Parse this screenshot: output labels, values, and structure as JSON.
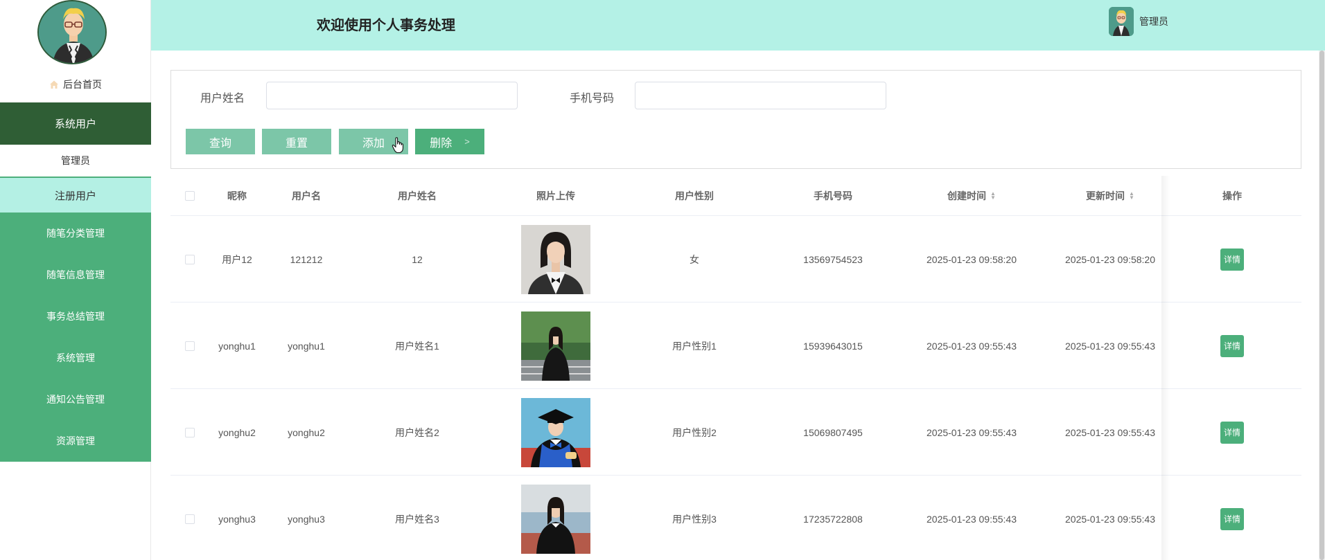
{
  "sidebar": {
    "home_label": "后台首页",
    "group_label": "系统用户",
    "sub_items": [
      "管理员",
      "注册用户"
    ],
    "menu_items": [
      "随笔分类管理",
      "随笔信息管理",
      "事务总结管理",
      "系统管理",
      "通知公告管理",
      "资源管理"
    ]
  },
  "header": {
    "title": "欢迎使用个人事务处理",
    "user_label": "管理员"
  },
  "search": {
    "name_label": "用户姓名",
    "name_value": "",
    "phone_label": "手机号码",
    "phone_value": "",
    "buttons": {
      "query": "查询",
      "reset": "重置",
      "add": "添加",
      "delete": "删除",
      "delete_arrow": ">"
    }
  },
  "table": {
    "columns": [
      "昵称",
      "用户名",
      "用户姓名",
      "照片上传",
      "用户性别",
      "手机号码",
      "创建时间",
      "更新时间",
      "操作"
    ],
    "rows": [
      {
        "nickname": "用户12",
        "username": "121212",
        "realname": "12",
        "gender": "女",
        "phone": "13569754523",
        "created": "2025-01-23 09:58:20",
        "updated": "2025-01-23 09:58:20",
        "action": "详情"
      },
      {
        "nickname": "yonghu1",
        "username": "yonghu1",
        "realname": "用户姓名1",
        "gender": "用户性别1",
        "phone": "15939643015",
        "created": "2025-01-23 09:55:43",
        "updated": "2025-01-23 09:55:43",
        "action": "详情"
      },
      {
        "nickname": "yonghu2",
        "username": "yonghu2",
        "realname": "用户姓名2",
        "gender": "用户性别2",
        "phone": "15069807495",
        "created": "2025-01-23 09:55:43",
        "updated": "2025-01-23 09:55:43",
        "action": "详情"
      },
      {
        "nickname": "yonghu3",
        "username": "yonghu3",
        "realname": "用户姓名3",
        "gender": "用户性别3",
        "phone": "17235722808",
        "created": "2025-01-23 09:55:43",
        "updated": "2025-01-23 09:55:43",
        "action": "详情"
      }
    ]
  },
  "colors": {
    "header_bg": "#b4f1e6",
    "menu_green": "#4caf7b",
    "menu_dark": "#2f5e35",
    "button_light": "#7cc6a8"
  },
  "icons": {
    "home": "home-icon",
    "cursor": "hand-cursor-icon"
  }
}
